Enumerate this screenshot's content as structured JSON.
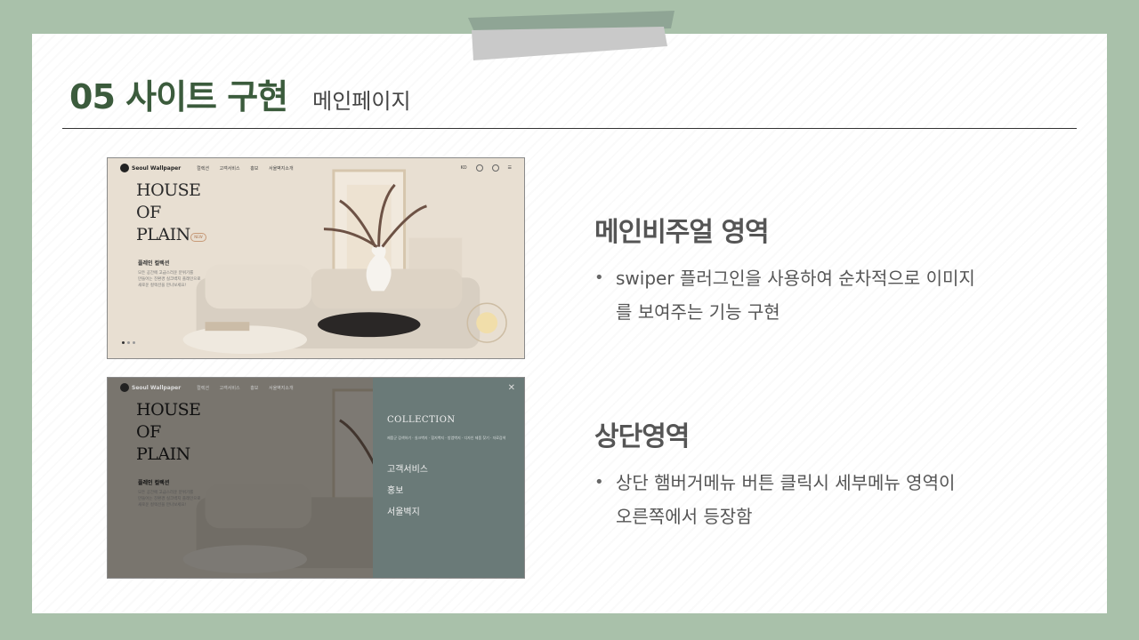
{
  "title": {
    "main": "05 사이트 구현",
    "sub": "메인페이지"
  },
  "mockup": {
    "logo": "Seoul Wallpaper",
    "nav": [
      "컬렉션",
      "고객서비스",
      "홍보",
      "서울벽지소개"
    ],
    "lang": "KO",
    "hero_lines": [
      "HOUSE",
      "OF",
      "PLAIN"
    ],
    "new_badge": "NEW",
    "promo_title": "플레인 컬렉션",
    "promo_lines": [
      "모든 공간에 고급스러운 분위기를",
      "만들어는 친환경 실크벽지 플레인으로",
      "새로운 컬렉션을 만나보세요!"
    ],
    "panel": {
      "collection": "COLLECTION",
      "collection_links": "제품군 검색하기 · 실크벽지 · 합지벽지 · 방염벽지 · 디자인 제품 찾기 · 자료검색",
      "menu": [
        "고객서비스",
        "홍보",
        "서울벽지"
      ]
    }
  },
  "sections": [
    {
      "title": "메인비주얼 영역",
      "bullet": "•",
      "lines": [
        "swiper 플러그인을 사용하여 순차적으로 이미지",
        "를 보여주는 기능 구현"
      ]
    },
    {
      "title": "상단영역",
      "bullet": "•",
      "lines": [
        "상단 햄버거메뉴 버튼 클릭시 세부메뉴 영역이",
        "오른쪽에서 등장함"
      ]
    }
  ],
  "colors": {
    "background": "#a9c1aa",
    "title_green": "#3b5b3c",
    "panel": "#6a7a78"
  }
}
